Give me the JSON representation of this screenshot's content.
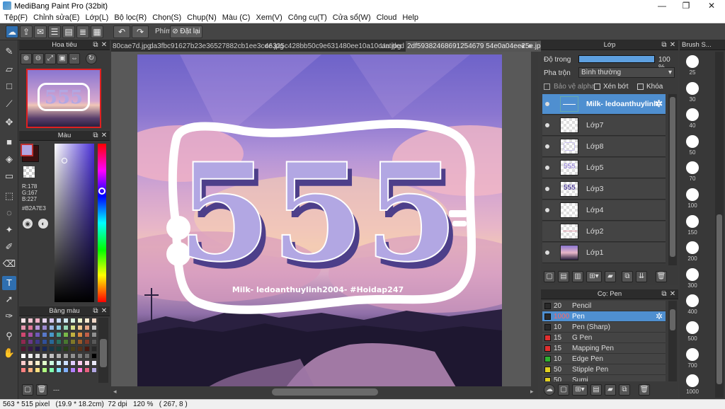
{
  "window": {
    "title": "MediBang Paint Pro (32bit)"
  },
  "menu": [
    "Tệp(F)",
    "Chỉnh sửa(E)",
    "Lớp(L)",
    "Bộ lọc(R)",
    "Chọn(S)",
    "Chụp(N)",
    "Màu (C)",
    "Xem(V)",
    "Công cụ(T)",
    "Cửa sổ(W)",
    "Cloud",
    "Help"
  ],
  "toolbar": {
    "shortcut_label": "Phím",
    "reset_label": "Đặt lại"
  },
  "tabs": [
    "80cae7d.jpg",
    "da3fbc91627b23e36527882cb1ee3cee.jpg",
    "46325c428bb50c9e631480ee10a10caa.jpg",
    "Untitled",
    "2df59382468691254679 54e0a04ee25e.jpg"
  ],
  "navigator": {
    "title": "Hoa tiêu"
  },
  "color": {
    "title": "Màu",
    "r": "R:178",
    "g": "G:167",
    "b": "B:227",
    "hex": "#B2A7E3",
    "primary": "#B2A7E3"
  },
  "palette": {
    "title": "Bảng màu",
    "footer": "---"
  },
  "layers": {
    "title": "Lớp",
    "opacity_label": "Độ trong",
    "opacity_value": "100 %",
    "opacity": 1.0,
    "blend_label": "Pha trộn",
    "blend_value": "Bình thường",
    "alpha_protect": "Bảo vệ alpha",
    "clipping": "Xén bớt",
    "lock": "Khóa",
    "items": [
      {
        "name": "Milk- ledoanthuylinh"
      },
      {
        "name": "Lớp7"
      },
      {
        "name": "Lớp8"
      },
      {
        "name": "Lớp5"
      },
      {
        "name": "Lớp3"
      },
      {
        "name": "Lớp4"
      },
      {
        "name": "Lớp2"
      },
      {
        "name": "Lớp1"
      }
    ]
  },
  "pens": {
    "title": "Cọ: Pen",
    "items": [
      {
        "size": "20",
        "name": "Pencil",
        "color": "#2a2a2a"
      },
      {
        "size": "1000",
        "name": "Pen",
        "color": "#2a2a2a"
      },
      {
        "size": "10",
        "name": "Pen (Sharp)",
        "color": "#2a2a2a"
      },
      {
        "size": "15",
        "name": "G Pen",
        "color": "#e03030"
      },
      {
        "size": "15",
        "name": "Mapping Pen",
        "color": "#e03030"
      },
      {
        "size": "10",
        "name": "Edge Pen",
        "color": "#30b030"
      },
      {
        "size": "50",
        "name": "Stipple Pen",
        "color": "#e0d020"
      },
      {
        "size": "50",
        "name": "Sumi",
        "color": "#e0d020"
      }
    ]
  },
  "brush_size": {
    "title": "Brush S...",
    "sizes": [
      "25",
      "30",
      "40",
      "50",
      "70",
      "100",
      "150",
      "200",
      "300",
      "400",
      "500",
      "700",
      "1000"
    ]
  },
  "artwork": {
    "big_text": "555",
    "caption": "Milk- ledoanthuylinh2004- #Hoidap247"
  },
  "status": "563 * 515 pixel   (19.9 * 18.2cm)  72 dpi   120 %   ( 267, 8 )"
}
